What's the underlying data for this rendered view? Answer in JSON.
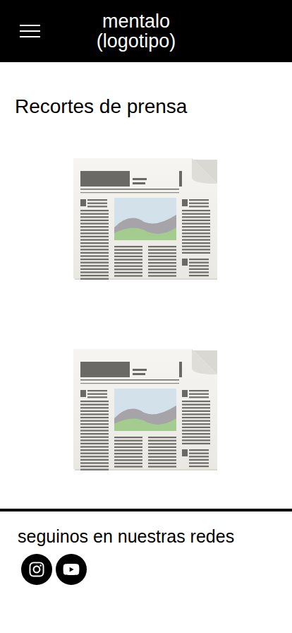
{
  "header": {
    "logo_lines": [
      "mentalo",
      "(logotipo)"
    ]
  },
  "section": {
    "title": "Recortes de prensa"
  },
  "clippings": [
    {},
    {}
  ],
  "footer": {
    "title": "seguinos en nuestras redes",
    "socials": [
      {
        "kind": "instagram"
      },
      {
        "kind": "youtube"
      }
    ]
  }
}
